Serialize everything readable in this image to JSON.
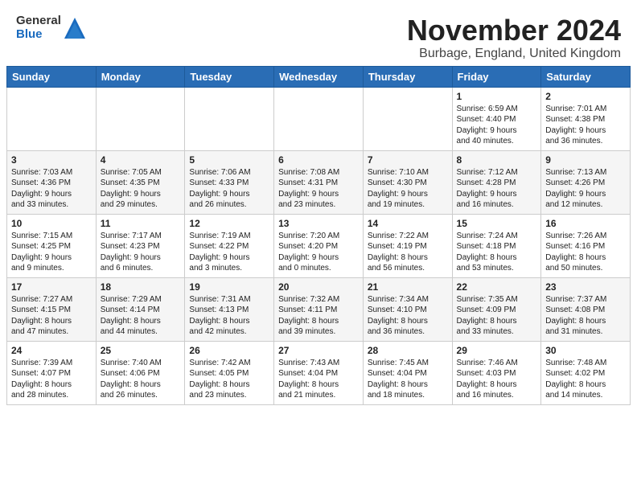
{
  "header": {
    "logo_general": "General",
    "logo_blue": "Blue",
    "month_title": "November 2024",
    "location": "Burbage, England, United Kingdom"
  },
  "weekdays": [
    "Sunday",
    "Monday",
    "Tuesday",
    "Wednesday",
    "Thursday",
    "Friday",
    "Saturday"
  ],
  "weeks": [
    [
      {
        "day": "",
        "info": ""
      },
      {
        "day": "",
        "info": ""
      },
      {
        "day": "",
        "info": ""
      },
      {
        "day": "",
        "info": ""
      },
      {
        "day": "",
        "info": ""
      },
      {
        "day": "1",
        "info": "Sunrise: 6:59 AM\nSunset: 4:40 PM\nDaylight: 9 hours\nand 40 minutes."
      },
      {
        "day": "2",
        "info": "Sunrise: 7:01 AM\nSunset: 4:38 PM\nDaylight: 9 hours\nand 36 minutes."
      }
    ],
    [
      {
        "day": "3",
        "info": "Sunrise: 7:03 AM\nSunset: 4:36 PM\nDaylight: 9 hours\nand 33 minutes."
      },
      {
        "day": "4",
        "info": "Sunrise: 7:05 AM\nSunset: 4:35 PM\nDaylight: 9 hours\nand 29 minutes."
      },
      {
        "day": "5",
        "info": "Sunrise: 7:06 AM\nSunset: 4:33 PM\nDaylight: 9 hours\nand 26 minutes."
      },
      {
        "day": "6",
        "info": "Sunrise: 7:08 AM\nSunset: 4:31 PM\nDaylight: 9 hours\nand 23 minutes."
      },
      {
        "day": "7",
        "info": "Sunrise: 7:10 AM\nSunset: 4:30 PM\nDaylight: 9 hours\nand 19 minutes."
      },
      {
        "day": "8",
        "info": "Sunrise: 7:12 AM\nSunset: 4:28 PM\nDaylight: 9 hours\nand 16 minutes."
      },
      {
        "day": "9",
        "info": "Sunrise: 7:13 AM\nSunset: 4:26 PM\nDaylight: 9 hours\nand 12 minutes."
      }
    ],
    [
      {
        "day": "10",
        "info": "Sunrise: 7:15 AM\nSunset: 4:25 PM\nDaylight: 9 hours\nand 9 minutes."
      },
      {
        "day": "11",
        "info": "Sunrise: 7:17 AM\nSunset: 4:23 PM\nDaylight: 9 hours\nand 6 minutes."
      },
      {
        "day": "12",
        "info": "Sunrise: 7:19 AM\nSunset: 4:22 PM\nDaylight: 9 hours\nand 3 minutes."
      },
      {
        "day": "13",
        "info": "Sunrise: 7:20 AM\nSunset: 4:20 PM\nDaylight: 9 hours\nand 0 minutes."
      },
      {
        "day": "14",
        "info": "Sunrise: 7:22 AM\nSunset: 4:19 PM\nDaylight: 8 hours\nand 56 minutes."
      },
      {
        "day": "15",
        "info": "Sunrise: 7:24 AM\nSunset: 4:18 PM\nDaylight: 8 hours\nand 53 minutes."
      },
      {
        "day": "16",
        "info": "Sunrise: 7:26 AM\nSunset: 4:16 PM\nDaylight: 8 hours\nand 50 minutes."
      }
    ],
    [
      {
        "day": "17",
        "info": "Sunrise: 7:27 AM\nSunset: 4:15 PM\nDaylight: 8 hours\nand 47 minutes."
      },
      {
        "day": "18",
        "info": "Sunrise: 7:29 AM\nSunset: 4:14 PM\nDaylight: 8 hours\nand 44 minutes."
      },
      {
        "day": "19",
        "info": "Sunrise: 7:31 AM\nSunset: 4:13 PM\nDaylight: 8 hours\nand 42 minutes."
      },
      {
        "day": "20",
        "info": "Sunrise: 7:32 AM\nSunset: 4:11 PM\nDaylight: 8 hours\nand 39 minutes."
      },
      {
        "day": "21",
        "info": "Sunrise: 7:34 AM\nSunset: 4:10 PM\nDaylight: 8 hours\nand 36 minutes."
      },
      {
        "day": "22",
        "info": "Sunrise: 7:35 AM\nSunset: 4:09 PM\nDaylight: 8 hours\nand 33 minutes."
      },
      {
        "day": "23",
        "info": "Sunrise: 7:37 AM\nSunset: 4:08 PM\nDaylight: 8 hours\nand 31 minutes."
      }
    ],
    [
      {
        "day": "24",
        "info": "Sunrise: 7:39 AM\nSunset: 4:07 PM\nDaylight: 8 hours\nand 28 minutes."
      },
      {
        "day": "25",
        "info": "Sunrise: 7:40 AM\nSunset: 4:06 PM\nDaylight: 8 hours\nand 26 minutes."
      },
      {
        "day": "26",
        "info": "Sunrise: 7:42 AM\nSunset: 4:05 PM\nDaylight: 8 hours\nand 23 minutes."
      },
      {
        "day": "27",
        "info": "Sunrise: 7:43 AM\nSunset: 4:04 PM\nDaylight: 8 hours\nand 21 minutes."
      },
      {
        "day": "28",
        "info": "Sunrise: 7:45 AM\nSunset: 4:04 PM\nDaylight: 8 hours\nand 18 minutes."
      },
      {
        "day": "29",
        "info": "Sunrise: 7:46 AM\nSunset: 4:03 PM\nDaylight: 8 hours\nand 16 minutes."
      },
      {
        "day": "30",
        "info": "Sunrise: 7:48 AM\nSunset: 4:02 PM\nDaylight: 8 hours\nand 14 minutes."
      }
    ]
  ]
}
